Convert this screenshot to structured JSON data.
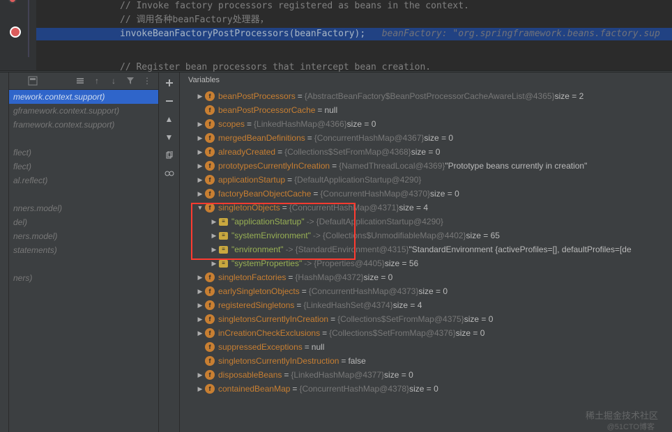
{
  "editor": {
    "line0_comment": "// Invoke factory processors registered as beans in the context.",
    "line1_comment": "// 调用各种beanFactory处理器，",
    "line2_code": "invokeBeanFactoryPostProcessors(beanFactory);",
    "line2_inline": "beanFactory: \"org.springframework.beans.factory.sup",
    "line3_comment": "// Register bean processors that intercept bean creation."
  },
  "frames": [
    "mework.context.support)",
    "gframework.context.support)",
    "framework.context.support)",
    "",
    "flect)",
    "flect)",
    "al.reflect)",
    "",
    "nners.model)",
    "del)",
    "ners.model)",
    "statements)",
    "",
    "ners)",
    ""
  ],
  "vars_title": "Variables",
  "vars": [
    {
      "d": 1,
      "arrow": ">",
      "ico": "f",
      "name": "beanPostProcessors",
      "val": "{AbstractBeanFactory$BeanPostProcessorCacheAwareList@4365}",
      "size": "size = 2"
    },
    {
      "d": 1,
      "arrow": "",
      "ico": "f",
      "name": "beanPostProcessorCache",
      "val": "null",
      "plain": true
    },
    {
      "d": 1,
      "arrow": ">",
      "ico": "f",
      "name": "scopes",
      "val": "{LinkedHashMap@4366}",
      "size": "size = 0"
    },
    {
      "d": 1,
      "arrow": ">",
      "ico": "f",
      "name": "mergedBeanDefinitions",
      "val": "{ConcurrentHashMap@4367}",
      "size": "size = 0"
    },
    {
      "d": 1,
      "arrow": ">",
      "ico": "f",
      "name": "alreadyCreated",
      "val": "{Collections$SetFromMap@4368}",
      "size": "size = 0"
    },
    {
      "d": 1,
      "arrow": ">",
      "ico": "f",
      "name": "prototypesCurrentlyInCreation",
      "val": "{NamedThreadLocal@4369}",
      "str": "\"Prototype beans currently in creation\""
    },
    {
      "d": 1,
      "arrow": ">",
      "ico": "f",
      "name": "applicationStartup",
      "val": "{DefaultApplicationStartup@4290}"
    },
    {
      "d": 1,
      "arrow": ">",
      "ico": "f",
      "name": "factoryBeanObjectCache",
      "val": "{ConcurrentHashMap@4370}",
      "size": "size = 0"
    },
    {
      "d": 1,
      "arrow": "v",
      "ico": "f",
      "name": "singletonObjects",
      "val": "{ConcurrentHashMap@4371}",
      "size": "size = 4"
    },
    {
      "d": 2,
      "arrow": ">",
      "ico": "m",
      "key": "\"applicationStartup\"",
      "mv": "{DefaultApplicationStartup@4290}"
    },
    {
      "d": 2,
      "arrow": ">",
      "ico": "m",
      "key": "\"systemEnvironment\"",
      "mv": "{Collections$UnmodifiableMap@4402}",
      "size": "size = 65"
    },
    {
      "d": 2,
      "arrow": ">",
      "ico": "m",
      "key": "\"environment\"",
      "mv": "{StandardEnvironment@4315}",
      "str": "\"StandardEnvironment {activeProfiles=[], defaultProfiles=[de"
    },
    {
      "d": 2,
      "arrow": ">",
      "ico": "m",
      "key": "\"systemProperties\"",
      "mv": "{Properties@4405}",
      "size": "size = 56"
    },
    {
      "d": 1,
      "arrow": ">",
      "ico": "f",
      "name": "singletonFactories",
      "val": "{HashMap@4372}",
      "size": "size = 0"
    },
    {
      "d": 1,
      "arrow": ">",
      "ico": "f",
      "name": "earlySingletonObjects",
      "val": "{ConcurrentHashMap@4373}",
      "size": "size = 0"
    },
    {
      "d": 1,
      "arrow": ">",
      "ico": "f",
      "name": "registeredSingletons",
      "val": "{LinkedHashSet@4374}",
      "size": "size = 4"
    },
    {
      "d": 1,
      "arrow": ">",
      "ico": "f",
      "name": "singletonsCurrentlyInCreation",
      "val": "{Collections$SetFromMap@4375}",
      "size": "size = 0"
    },
    {
      "d": 1,
      "arrow": ">",
      "ico": "f",
      "name": "inCreationCheckExclusions",
      "val": "{Collections$SetFromMap@4376}",
      "size": "size = 0"
    },
    {
      "d": 1,
      "arrow": "",
      "ico": "f",
      "name": "suppressedExceptions",
      "val": "null",
      "plain": true
    },
    {
      "d": 1,
      "arrow": "",
      "ico": "f",
      "name": "singletonsCurrentlyInDestruction",
      "val": "false",
      "plain": true
    },
    {
      "d": 1,
      "arrow": ">",
      "ico": "f",
      "name": "disposableBeans",
      "val": "{LinkedHashMap@4377}",
      "size": "size = 0"
    },
    {
      "d": 1,
      "arrow": ">",
      "ico": "f",
      "name": "containedBeanMap",
      "val": "{ConcurrentHashMap@4378}",
      "size": "size = 0"
    }
  ],
  "watermark1": "稀土掘金技术社区",
  "watermark2": "@51CTO博客"
}
